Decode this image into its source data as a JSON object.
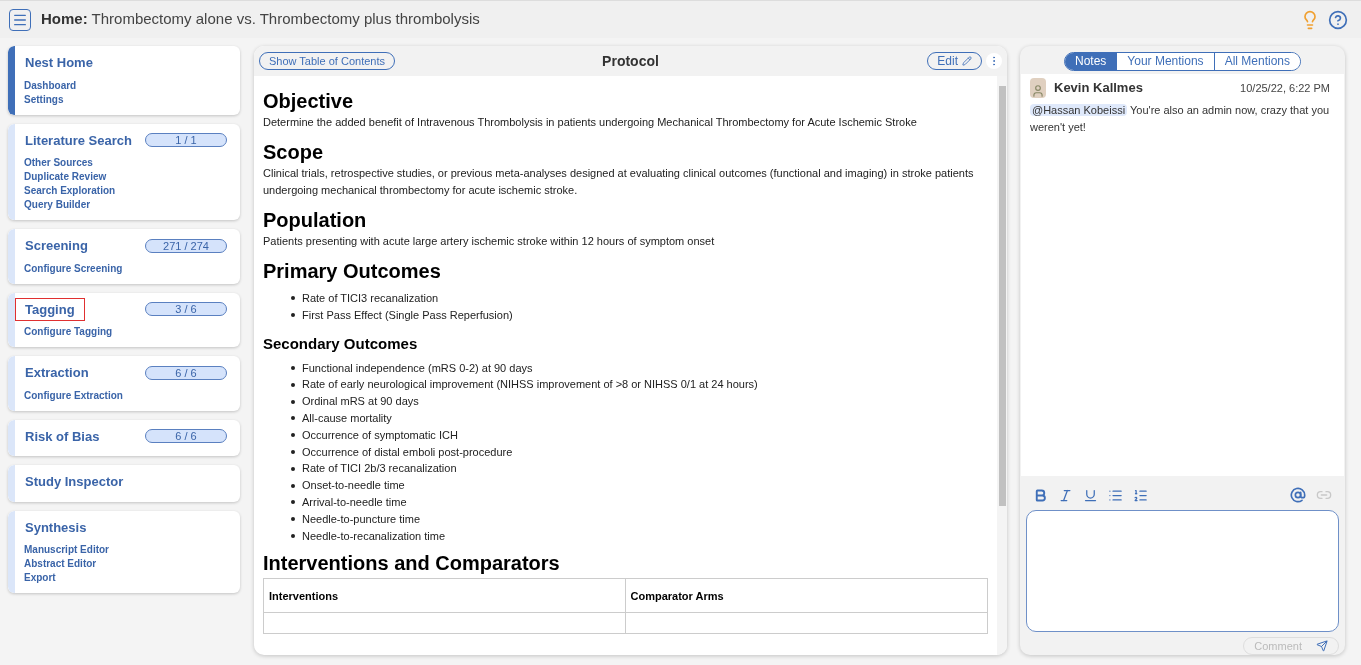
{
  "header": {
    "title_bold": "Home:",
    "title": "Thrombectomy alone vs. Thrombectomy plus thrombolysis"
  },
  "sidebar": [
    {
      "title": "Nest Home",
      "selected": true,
      "highlighted": false,
      "links": [
        "Dashboard",
        "Settings"
      ]
    },
    {
      "title": "Literature Search",
      "progress": "1 / 1",
      "selected": false,
      "highlighted": false,
      "links": [
        "Other Sources",
        "Duplicate Review",
        "Search Exploration",
        "Query Builder"
      ]
    },
    {
      "title": "Screening",
      "progress": "271 / 274",
      "selected": false,
      "highlighted": false,
      "links": [
        "Configure Screening"
      ]
    },
    {
      "title": "Tagging",
      "progress": "3 / 6",
      "selected": false,
      "highlighted": true,
      "links": [
        "Configure Tagging"
      ]
    },
    {
      "title": "Extraction",
      "progress": "6 / 6",
      "selected": false,
      "highlighted": false,
      "links": [
        "Configure Extraction"
      ]
    },
    {
      "title": "Risk of Bias",
      "progress": "6 / 6",
      "selected": false,
      "highlighted": false
    },
    {
      "title": "Study Inspector",
      "selected": false,
      "highlighted": false
    },
    {
      "title": "Synthesis",
      "selected": false,
      "highlighted": false,
      "links": [
        "Manuscript Editor",
        "Abstract Editor",
        "Export"
      ]
    }
  ],
  "protocol": {
    "toc_button": "Show Table of Contents",
    "title": "Protocol",
    "edit_button": "Edit",
    "blocks": [
      {
        "kind": "h1",
        "text": "Objective"
      },
      {
        "kind": "p",
        "text": "Determine the added benefit of Intravenous Thrombolysis in patients undergoing Mechanical Thrombectomy for Acute Ischemic Stroke"
      },
      {
        "kind": "h1",
        "text": "Scope"
      },
      {
        "kind": "p",
        "text": "Clinical trials, retrospective studies, or previous meta-analyses designed at evaluating clinical outcomes (functional and imaging) in stroke patients undergoing mechanical thrombectomy for acute ischemic stroke."
      },
      {
        "kind": "h1",
        "text": "Population"
      },
      {
        "kind": "p",
        "text": "Patients presenting with acute large artery ischemic stroke within 12 hours of symptom onset"
      },
      {
        "kind": "h1",
        "text": "Primary Outcomes"
      },
      {
        "kind": "list",
        "items": [
          "Rate of TICI3 recanalization",
          "First Pass Effect (Single Pass Reperfusion)"
        ]
      },
      {
        "kind": "h2",
        "text": "Secondary Outcomes"
      },
      {
        "kind": "list",
        "items": [
          "Functional independence (mRS 0-2) at 90 days",
          "Rate of early neurological improvement (NIHSS improvement of >8 or NIHSS 0/1 at 24 hours)",
          "Ordinal mRS at 90 days",
          "All-cause mortality",
          "Occurrence of symptomatic ICH",
          "Occurrence of distal emboli post-procedure",
          "Rate of TICI 2b/3 recanalization",
          "Onset-to-needle time",
          "Arrival-to-needle time",
          "Needle-to-puncture time",
          "Needle-to-recanalization time"
        ]
      },
      {
        "kind": "h1",
        "text": "Interventions and Comparators"
      },
      {
        "kind": "table",
        "columns": [
          "Interventions",
          "Comparator Arms"
        ]
      }
    ]
  },
  "notes": {
    "tabs": [
      {
        "label": "Notes",
        "selected": true
      },
      {
        "label": "Your Mentions",
        "selected": false
      },
      {
        "label": "All Mentions",
        "selected": false
      }
    ],
    "items": [
      {
        "author": "Kevin Kallmes",
        "time": "10/25/22, 6:22 PM",
        "mention": "@Hassan Kobeissi",
        "text": "You're also an admin now, crazy that you weren't yet!"
      }
    ],
    "comment_button": "Comment"
  }
}
